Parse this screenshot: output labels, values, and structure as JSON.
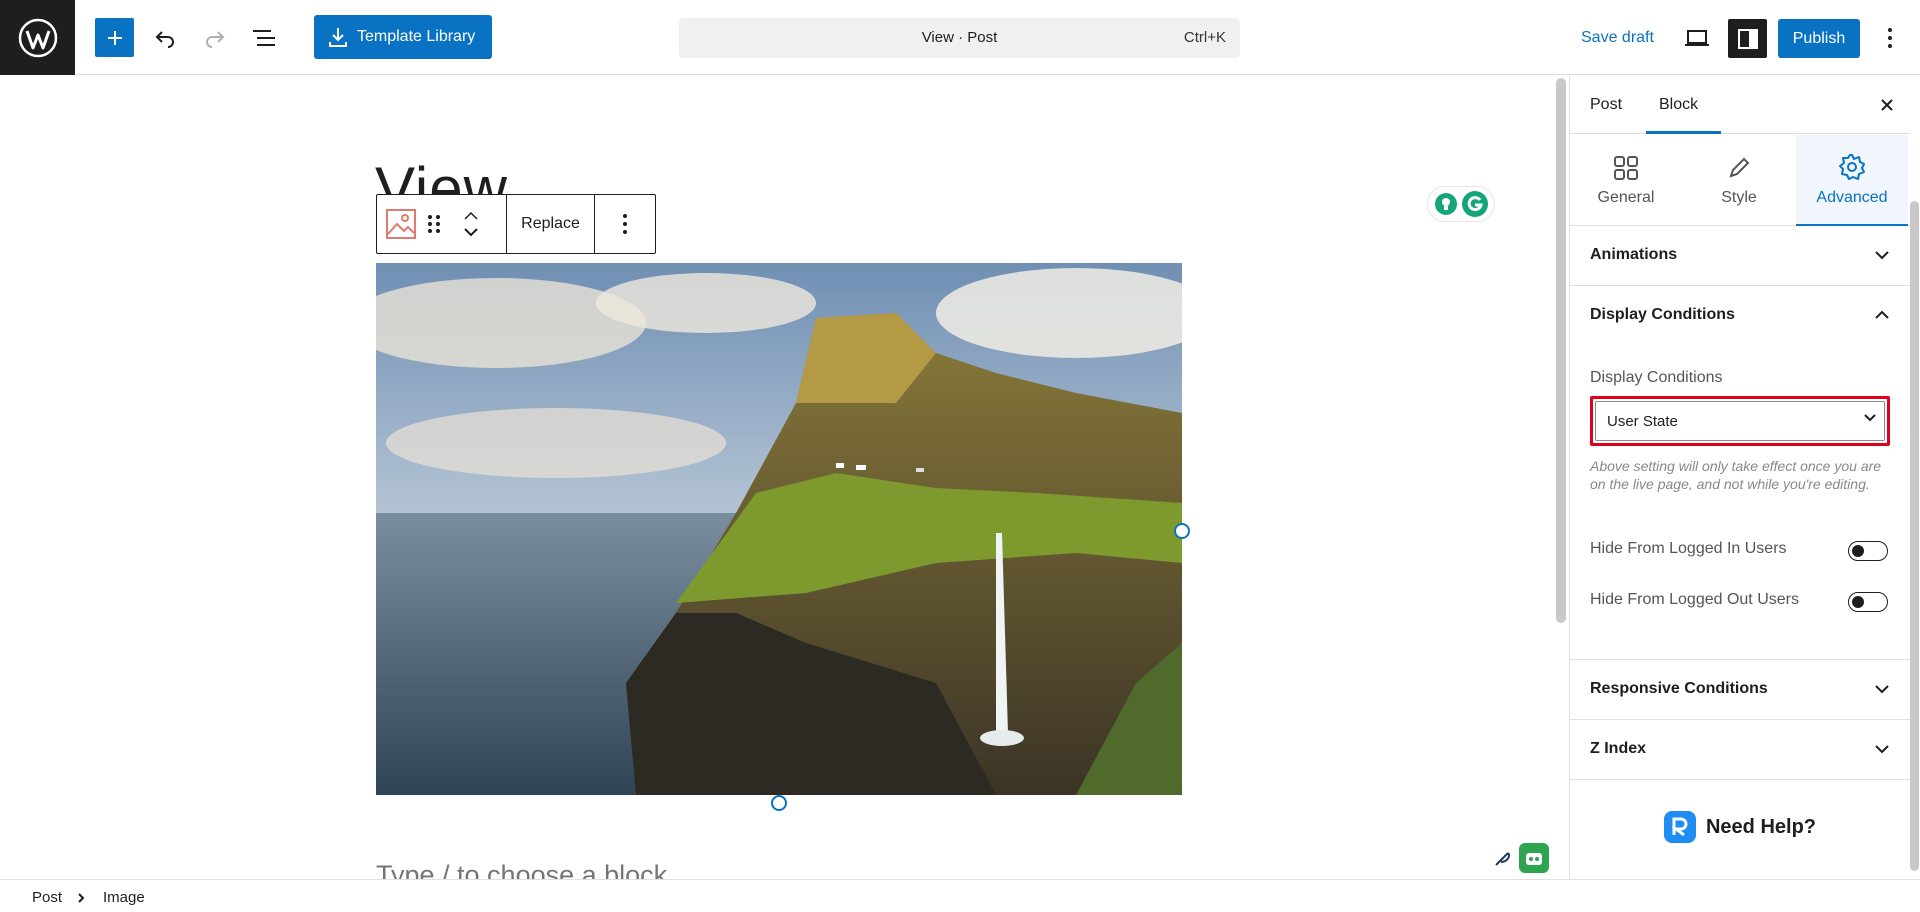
{
  "header": {
    "template_library_label": "Template Library",
    "command_bar_title": "View · Post",
    "command_bar_shortcut": "Ctrl+K",
    "save_draft_label": "Save draft",
    "publish_label": "Publish"
  },
  "canvas": {
    "post_title": "View",
    "block_toolbar": {
      "replace_label": "Replace"
    },
    "type_hint": "Type / to choose a block"
  },
  "sidebar": {
    "tabs": [
      {
        "label": "Post"
      },
      {
        "label": "Block"
      }
    ],
    "active_tab": "Block",
    "subtabs": [
      {
        "label": "General"
      },
      {
        "label": "Style"
      },
      {
        "label": "Advanced"
      }
    ],
    "active_subtab": "Advanced",
    "panels": {
      "animations": "Animations",
      "display_conditions": "Display Conditions",
      "responsive_conditions": "Responsive Conditions",
      "z_index": "Z Index"
    },
    "display_conditions": {
      "field_label": "Display Conditions",
      "selected_value": "User State",
      "help_text": "Above setting will only take effect once you are on the live page, and not while you're editing.",
      "toggles": [
        {
          "label": "Hide From Logged In Users",
          "on": false
        },
        {
          "label": "Hide From Logged Out Users",
          "on": false
        }
      ]
    },
    "need_help": "Need Help?"
  },
  "footer": {
    "breadcrumbs": [
      "Post",
      "Image"
    ]
  },
  "colors": {
    "accent": "#0a72c2",
    "highlight_border": "#e0001b",
    "dark": "#1e1e1e"
  }
}
